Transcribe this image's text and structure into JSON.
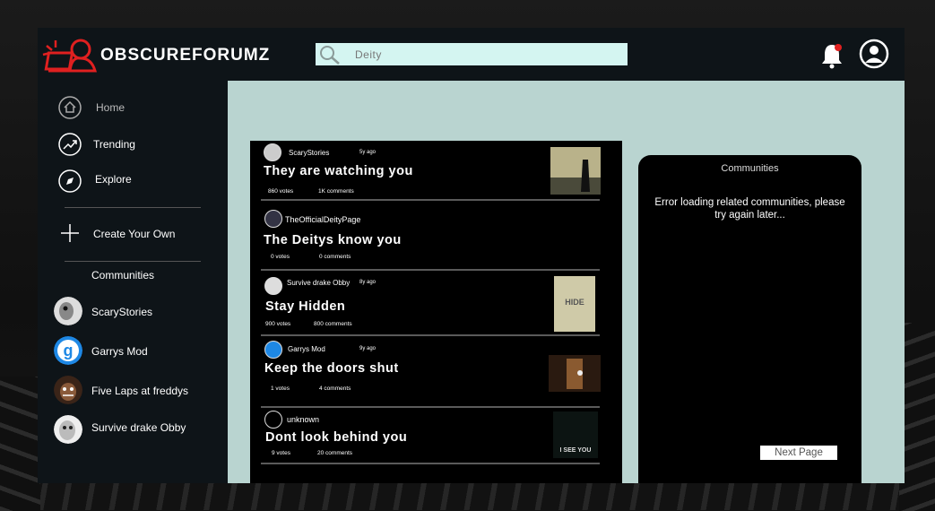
{
  "app": {
    "brand": "OBSCUREFORUMZ"
  },
  "search": {
    "value": "Deity"
  },
  "notifications": {
    "badge": "1"
  },
  "sidebar": {
    "nav": [
      {
        "label": "Home",
        "icon": "home-icon"
      },
      {
        "label": "Trending",
        "icon": "trending-icon"
      },
      {
        "label": "Explore",
        "icon": "compass-icon"
      },
      {
        "label": "Create Your Own",
        "icon": "plus-icon"
      }
    ],
    "communities_title": "Communities",
    "communities": [
      {
        "name": "ScaryStories"
      },
      {
        "name": "Garrys Mod"
      },
      {
        "name": "Five Laps at freddys"
      },
      {
        "name": "Survive drake Obby"
      }
    ]
  },
  "feed": {
    "posts": [
      {
        "community": "ScaryStories",
        "age": "5y ago",
        "title": "They are watching you",
        "votes": "860 votes",
        "comments": "1K comments"
      },
      {
        "community": "TheOfficialDeityPage",
        "age": "",
        "title": "The Deitys know you",
        "votes": "0 votes",
        "comments": "0 comments"
      },
      {
        "community": "Survive drake Obby",
        "age": "8y ago",
        "title": "Stay Hidden",
        "votes": "900 votes",
        "comments": "800 comments",
        "thumb_text": "HIDE"
      },
      {
        "community": "Garrys Mod",
        "age": "9y ago",
        "title": "Keep the doors shut",
        "votes": "1 votes",
        "comments": "4 comments"
      },
      {
        "community": "unknown",
        "age": "",
        "title": "Dont look behind you",
        "votes": "9 votes",
        "comments": "20 comments",
        "thumb_text": "I SEE YOU"
      }
    ]
  },
  "right_panel": {
    "title": "Communities",
    "error": "Error loading related communities, please try again later...",
    "next_page": "Next Page"
  },
  "colors": {
    "app_bg": "#b9d4d0",
    "bar_bg": "#0e1418",
    "search_bg": "#d4f5f1",
    "logo_red": "#e02020",
    "badge_red": "#e02020"
  }
}
